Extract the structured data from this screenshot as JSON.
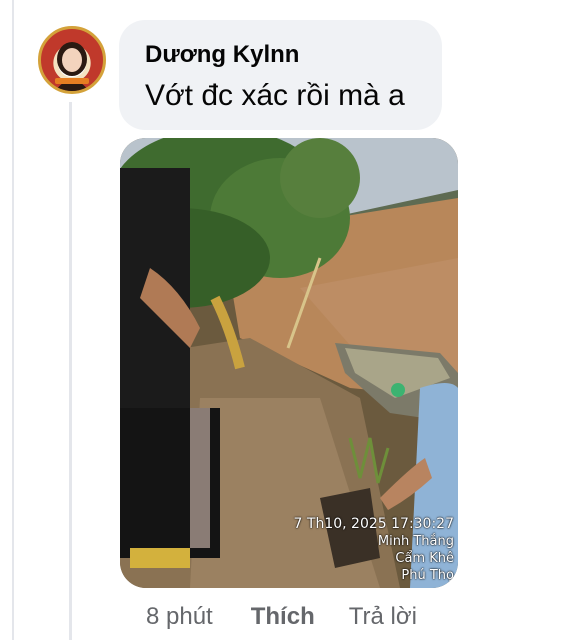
{
  "comment": {
    "author": "Dương Kylnn",
    "text": "Vớt đc xác rồi mà a",
    "avatar_icon": "profile-avatar"
  },
  "photo": {
    "timestamp": "7 Th10, 2025 17:30:27",
    "location_lines": [
      "Minh Thắng",
      "Cẩm Khê",
      "Phú Thọ"
    ]
  },
  "actions": {
    "time": "8 phút",
    "like_label": "Thích",
    "reply_label": "Trả lời"
  },
  "colors": {
    "bubble_bg": "#f0f2f5",
    "text_primary": "#050505",
    "text_secondary": "#65676b",
    "thread_line": "#e4e6eb"
  }
}
